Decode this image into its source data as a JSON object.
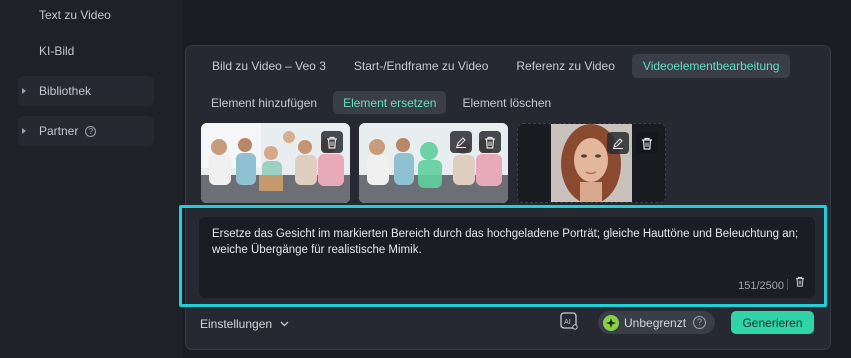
{
  "sidebar": {
    "items": [
      {
        "label": "Text zu Video"
      },
      {
        "label": "KI-Bild"
      },
      {
        "label": "Bibliothek"
      },
      {
        "label": "Partner"
      }
    ]
  },
  "tabs": [
    {
      "label": "Bild zu Video – Veo 3"
    },
    {
      "label": "Start-/Endframe zu Video"
    },
    {
      "label": "Referenz zu Video"
    },
    {
      "label": "Videoelementbearbeitung"
    }
  ],
  "subtabs": [
    {
      "label": "Element hinzufügen"
    },
    {
      "label": "Element ersetzen"
    },
    {
      "label": "Element löschen"
    }
  ],
  "prompt": {
    "text": "Ersetze das Gesicht im markierten Bereich durch das hochgeladene Porträt; gleiche Hauttöne und Beleuchtung an; weiche Übergänge für realistische Mimik.",
    "counter": "151/2500"
  },
  "footer": {
    "settings_label": "Einstellungen",
    "credits_label": "Unbegrenzt",
    "generate_label": "Generieren"
  },
  "colors": {
    "accent": "#5fe0c7",
    "highlight_frame": "#1fd1d6",
    "generate_button": "#2fd4a9"
  }
}
